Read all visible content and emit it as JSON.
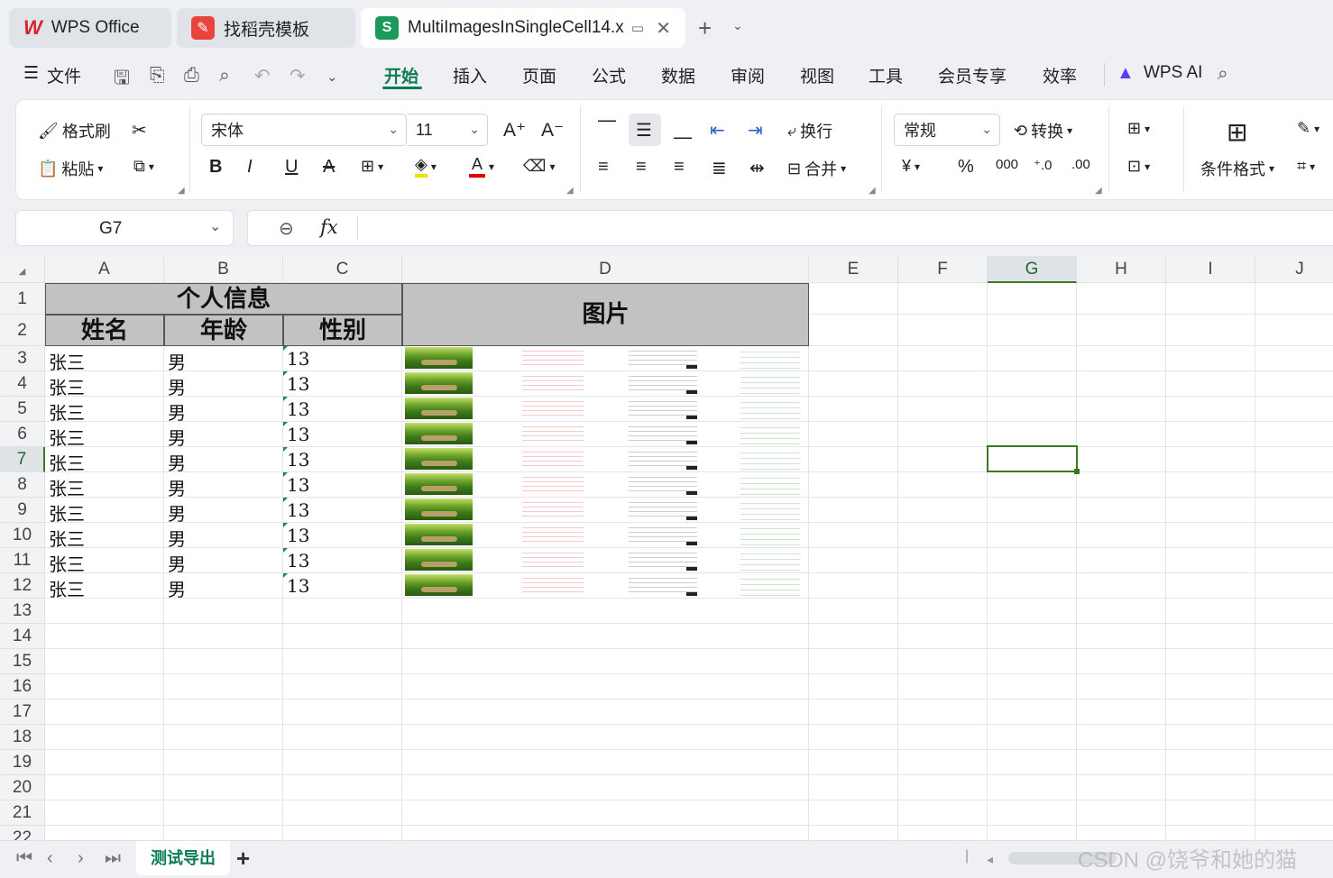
{
  "tabs": [
    {
      "label": "WPS Office"
    },
    {
      "label": "找稻壳模板"
    },
    {
      "label": "MultiImagesInSingleCell14.x"
    }
  ],
  "menu": {
    "file": "文件",
    "items": [
      "开始",
      "插入",
      "页面",
      "公式",
      "数据",
      "审阅",
      "视图",
      "工具",
      "会员专享",
      "效率"
    ],
    "wps_ai": "WPS AI"
  },
  "ribbon": {
    "format_painter": "格式刷",
    "paste": "粘贴",
    "font_name": "宋体",
    "font_size": "11",
    "wrap": "换行",
    "merge": "合并",
    "number_format": "常规",
    "convert": "转换",
    "conditional_format": "条件格式",
    "bold": "B",
    "italic": "I",
    "underline": "U",
    "font_color_letter": "A"
  },
  "formula_bar": {
    "name_box": "G7",
    "fx": "fx",
    "content": ""
  },
  "columns": [
    "A",
    "B",
    "C",
    "D",
    "E",
    "F",
    "G",
    "H",
    "I",
    "J"
  ],
  "rows": [
    "1",
    "2",
    "3",
    "4",
    "5",
    "6",
    "7",
    "8",
    "9",
    "10",
    "11",
    "12",
    "13",
    "14",
    "15",
    "16",
    "17",
    "18",
    "19",
    "20",
    "21",
    "22"
  ],
  "sheet": {
    "header_group": "个人信息",
    "header_image": "图片",
    "header_name": "姓名",
    "header_age": "年龄",
    "header_gender": "性别",
    "data_rows": [
      {
        "name": "张三",
        "gender_col": "男",
        "num": "13"
      },
      {
        "name": "张三",
        "gender_col": "男",
        "num": "13"
      },
      {
        "name": "张三",
        "gender_col": "男",
        "num": "13"
      },
      {
        "name": "张三",
        "gender_col": "男",
        "num": "13"
      },
      {
        "name": "张三",
        "gender_col": "男",
        "num": "13"
      },
      {
        "name": "张三",
        "gender_col": "男",
        "num": "13"
      },
      {
        "name": "张三",
        "gender_col": "男",
        "num": "13"
      },
      {
        "name": "张三",
        "gender_col": "男",
        "num": "13"
      },
      {
        "name": "张三",
        "gender_col": "男",
        "num": "13"
      },
      {
        "name": "张三",
        "gender_col": "男",
        "num": "13"
      }
    ]
  },
  "sheet_tabs": [
    {
      "label": "测试导出"
    }
  ],
  "add_sheet": "+",
  "watermark": "CSDN @饶爷和她的猫",
  "colors": {
    "accent": "#0c7a53",
    "selection": "#3a7a1c",
    "header_fill": "#c2c2c2"
  }
}
